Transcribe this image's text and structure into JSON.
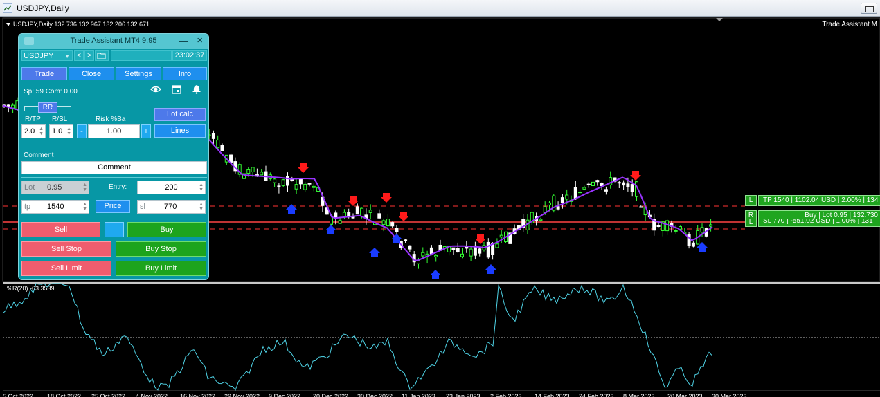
{
  "window": {
    "title": "USDJPY,Daily"
  },
  "chart": {
    "header": "USDJPY,Daily  132.736 132.967 132.206 132.671",
    "ea_name": "Trade Assistant M",
    "indicator_label": "%R(20) -63.3539",
    "x_labels": [
      "5 Oct 2022",
      "18 Oct 2022",
      "25 Oct 2022",
      "4 Nov 2022",
      "16 Nov 2022",
      "29 Nov 2022",
      "9 Dec 2022",
      "20 Dec 2022",
      "30 Dec 2022",
      "11 Jan 2023",
      "23 Jan 2023",
      "2 Feb 2023",
      "14 Feb 2023",
      "24 Feb 2023",
      "8 Mar 2023",
      "20 Mar 2023",
      "30 Mar 2023"
    ],
    "colors": {
      "bg": "#000000",
      "bull": "#33ff33",
      "bear": "#ffffff",
      "ma": "#9933ff",
      "wpr": "#4fd3e6",
      "tp_line": "#ff3333",
      "sl_line": "#ff3333",
      "entry_line": "#ff4444",
      "up_arrow": "#1a3cff",
      "down_arrow": "#ff1a1a"
    }
  },
  "levels": {
    "tp": {
      "tag": "L",
      "text": "TP 1540 | 1102.04 USD | 2.00% | 134"
    },
    "entry": {
      "tag": "R",
      "text": "Buy | Lot 0.95 | 132.730"
    },
    "sl": {
      "tag": "L",
      "text": "SL 770 | -551.02 USD | 1.00% | 131"
    }
  },
  "panel": {
    "title": "Trade Assistant MT4 9.95",
    "min_icon": "minimize-icon",
    "close_icon": "close-icon",
    "symbol": "USDJPY",
    "time": "23:02:37",
    "tabs": [
      "Trade",
      "Close",
      "Settings",
      "Info"
    ],
    "spread_info": "Sp: 59  Com: 0.00",
    "rr_label": "RR",
    "rtp_label": "R/TP",
    "rsl_label": "R/SL",
    "risk_label": "Risk %Ba",
    "rtp_value": "2.0",
    "rsl_value": "1.0",
    "risk_value": "1.00",
    "minus": "-",
    "plus": "+",
    "lot_calc": "Lot calc",
    "lines": "Lines",
    "comment_label": "Comment",
    "comment_value": "Comment",
    "lot_label": "Lot",
    "lot_value": "0.95",
    "entry_label": "Entry:",
    "entry_value": "200",
    "tp_label": "tp",
    "tp_value": "1540",
    "price_btn": "Price",
    "sl_label": "sl",
    "sl_value": "770",
    "sell": "Sell",
    "buy": "Buy",
    "sell_stop": "Sell Stop",
    "buy_stop": "Buy Stop",
    "sell_limit": "Sell Limit",
    "buy_limit": "Buy Limit"
  }
}
